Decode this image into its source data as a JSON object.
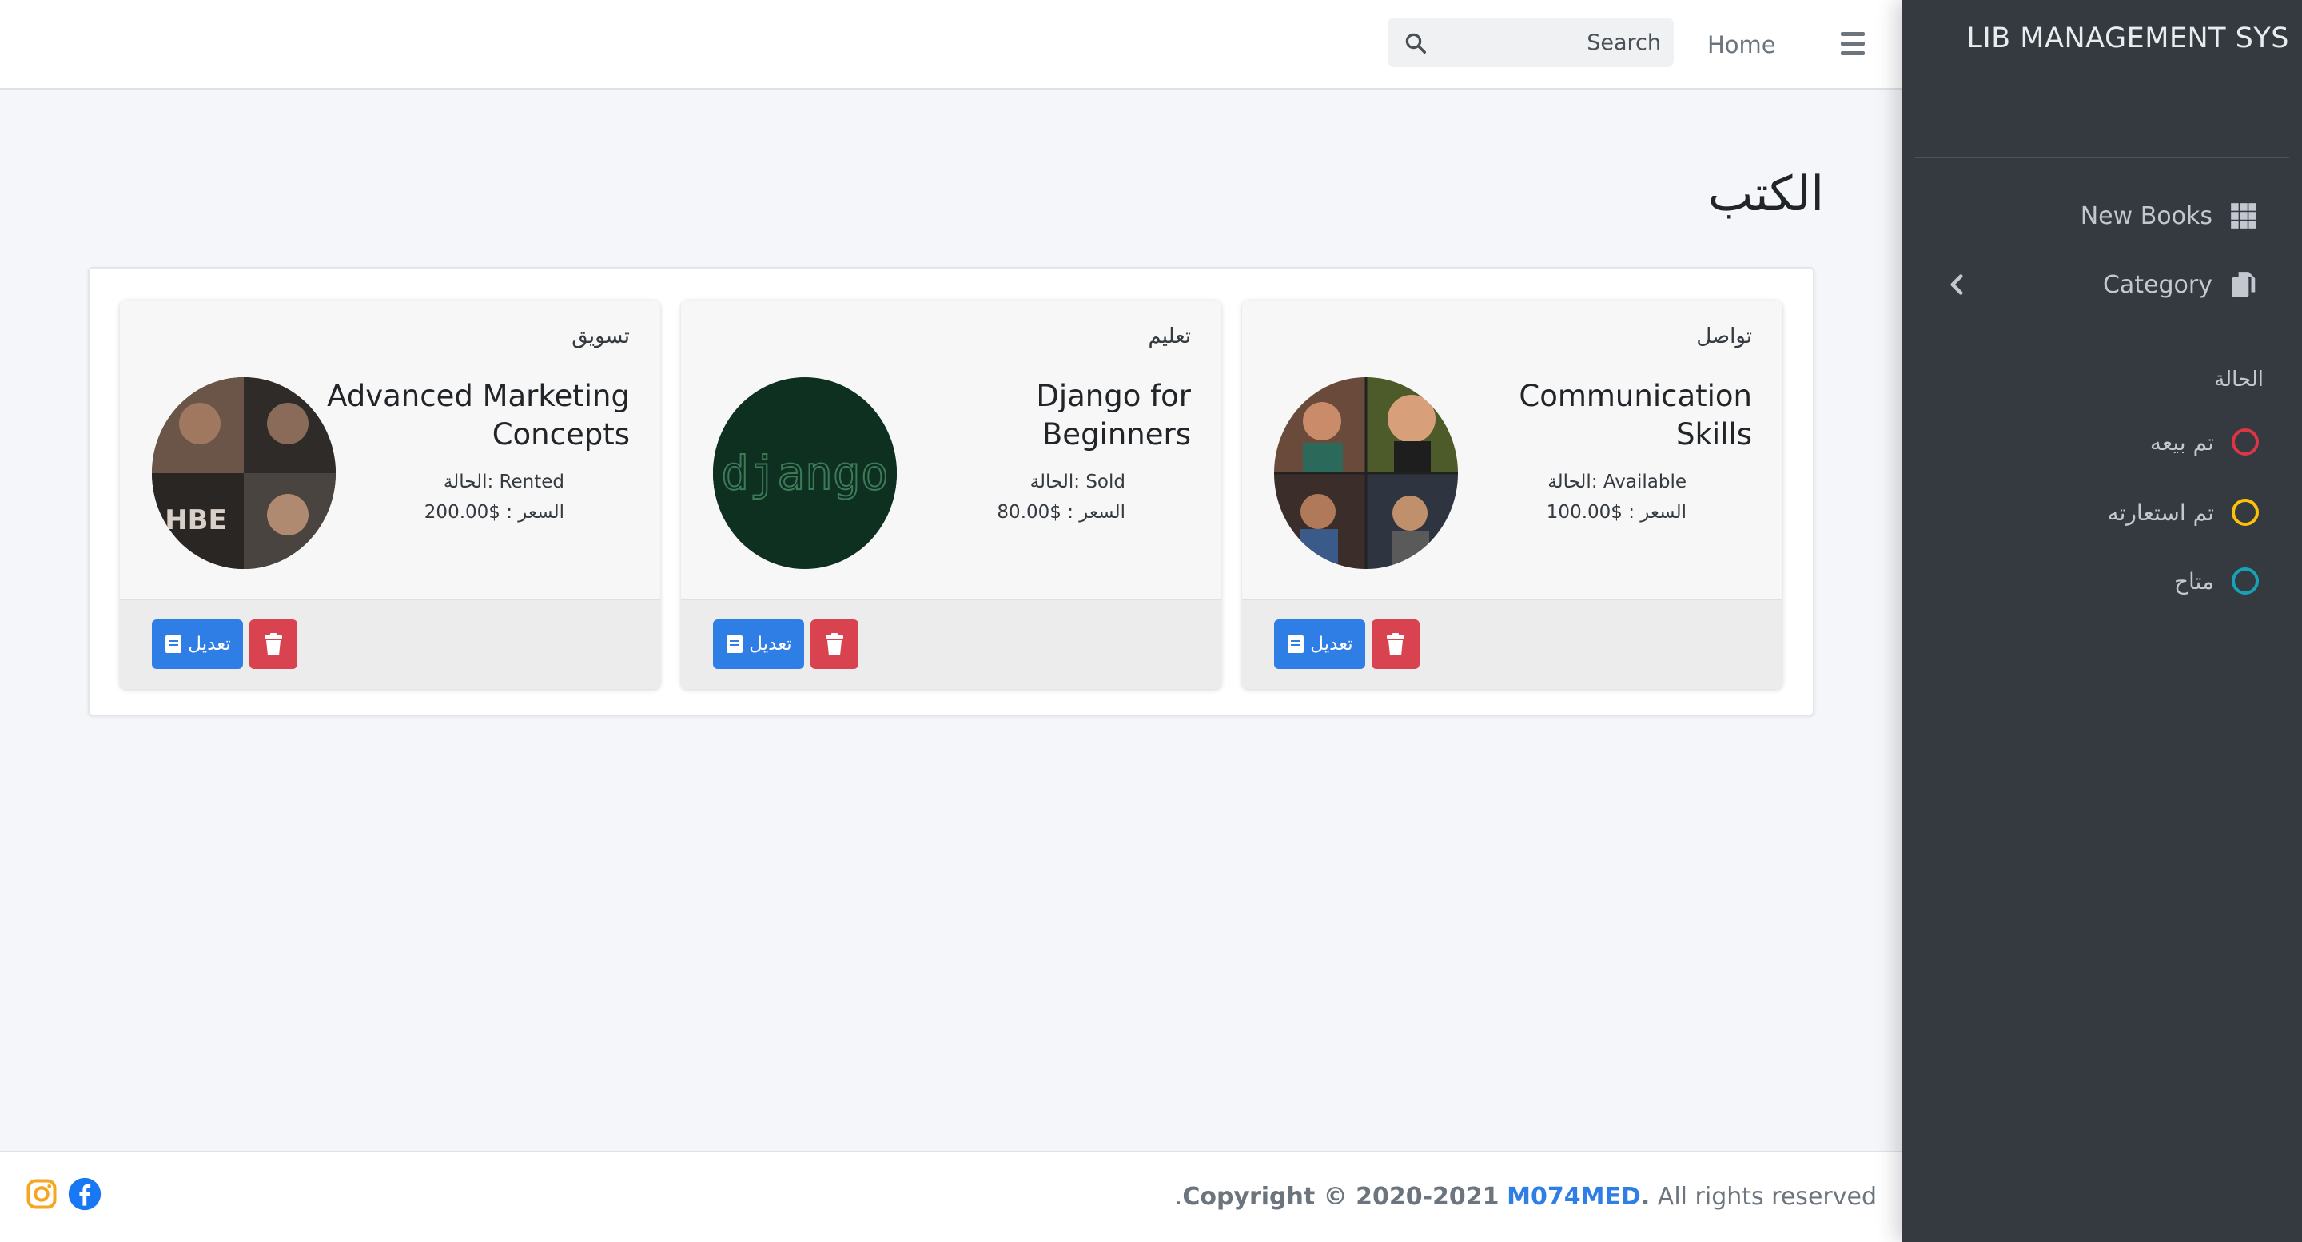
{
  "navbar": {
    "home_label": "Home",
    "search_placeholder": "Search"
  },
  "sidebar": {
    "brand": "LIB MANAGEMENT SYS",
    "items": [
      {
        "label": "New Books",
        "icon": "grid-icon"
      },
      {
        "label": "Category",
        "icon": "copy-icon"
      }
    ],
    "status_header": "الحالة",
    "statuses": [
      {
        "label": "تم بيعه",
        "color": "#dc3545"
      },
      {
        "label": "تم استعارته",
        "color": "#ffc107"
      },
      {
        "label": "متاح",
        "color": "#17a2b8"
      }
    ]
  },
  "main": {
    "title": "الكتب",
    "books": [
      {
        "category": "تواصل",
        "title": "Communication Skills",
        "status_line": "الحالة: Available",
        "price_line": "السعر : $100.00",
        "edit_label": "تعديل"
      },
      {
        "category": "تعليم",
        "title": "Django for Beginners",
        "status_line": "الحالة: Sold",
        "price_line": "السعر : $80.00",
        "edit_label": "تعديل",
        "image_text": "django"
      },
      {
        "category": "تسويق",
        "title": "Advanced Marketing Concepts",
        "status_line": "الحالة: Rented",
        "price_line": "السعر : $200.00",
        "edit_label": "تعديل"
      }
    ]
  },
  "footer": {
    "copyright_prefix": "Copyright © 2020-2021",
    "author": "M074MED",
    "suffix": "All rights reserved",
    "dot_start": ".",
    "dot_mid": "."
  },
  "colors": {
    "accent": "#2f7ee6",
    "danger": "#d9434f",
    "sidebar_bg": "#343a40"
  }
}
